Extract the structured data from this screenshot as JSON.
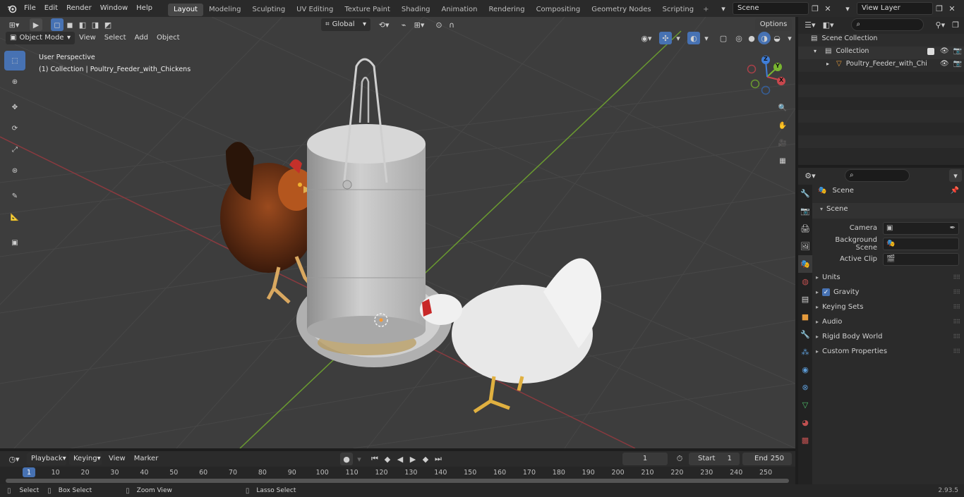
{
  "menus": [
    "File",
    "Edit",
    "Render",
    "Window",
    "Help"
  ],
  "workspaces": [
    {
      "label": "Layout",
      "active": true
    },
    {
      "label": "Modeling"
    },
    {
      "label": "Sculpting"
    },
    {
      "label": "UV Editing"
    },
    {
      "label": "Texture Paint"
    },
    {
      "label": "Shading"
    },
    {
      "label": "Animation"
    },
    {
      "label": "Rendering"
    },
    {
      "label": "Compositing"
    },
    {
      "label": "Geometry Nodes"
    },
    {
      "label": "Scripting"
    }
  ],
  "scene_name": "Scene",
  "view_layer": "View Layer",
  "viewport": {
    "mode": "Object Mode",
    "menus": [
      "View",
      "Select",
      "Add",
      "Object"
    ],
    "transform_orientation": "Global",
    "options_label": "Options",
    "overlay_line1": "User Perspective",
    "overlay_line2": "(1) Collection | Poultry_Feeder_with_Chickens",
    "gizmo": {
      "x": "X",
      "y": "Y",
      "z": "Z"
    }
  },
  "outliner": {
    "root": "Scene Collection",
    "collection": "Collection",
    "object": "Poultry_Feeder_with_Chi"
  },
  "properties": {
    "header": "Scene",
    "panel": "Scene",
    "fields": [
      {
        "label": "Camera"
      },
      {
        "label": "Background Scene"
      },
      {
        "label": "Active Clip"
      }
    ],
    "subpanels": [
      "Units",
      "Gravity",
      "Keying Sets",
      "Audio",
      "Rigid Body World",
      "Custom Properties"
    ]
  },
  "timeline": {
    "menus": [
      "Playback",
      "Keying",
      "View",
      "Marker"
    ],
    "current_frame": "1",
    "start_label": "Start",
    "start": "1",
    "end_label": "End",
    "end": "250",
    "ruler": [
      "1",
      "10",
      "20",
      "30",
      "40",
      "50",
      "60",
      "70",
      "80",
      "90",
      "100",
      "110",
      "120",
      "130",
      "140",
      "150",
      "160",
      "170",
      "180",
      "190",
      "200",
      "210",
      "220",
      "230",
      "240",
      "250"
    ]
  },
  "status": {
    "items": [
      "Select",
      "Box Select",
      "Zoom View",
      "Lasso Select"
    ],
    "version": "2.93.5"
  },
  "colors": {
    "accent": "#4772b3",
    "x_axis": "#c8474d",
    "y_axis": "#79b530",
    "z_axis": "#3f7ed9"
  }
}
